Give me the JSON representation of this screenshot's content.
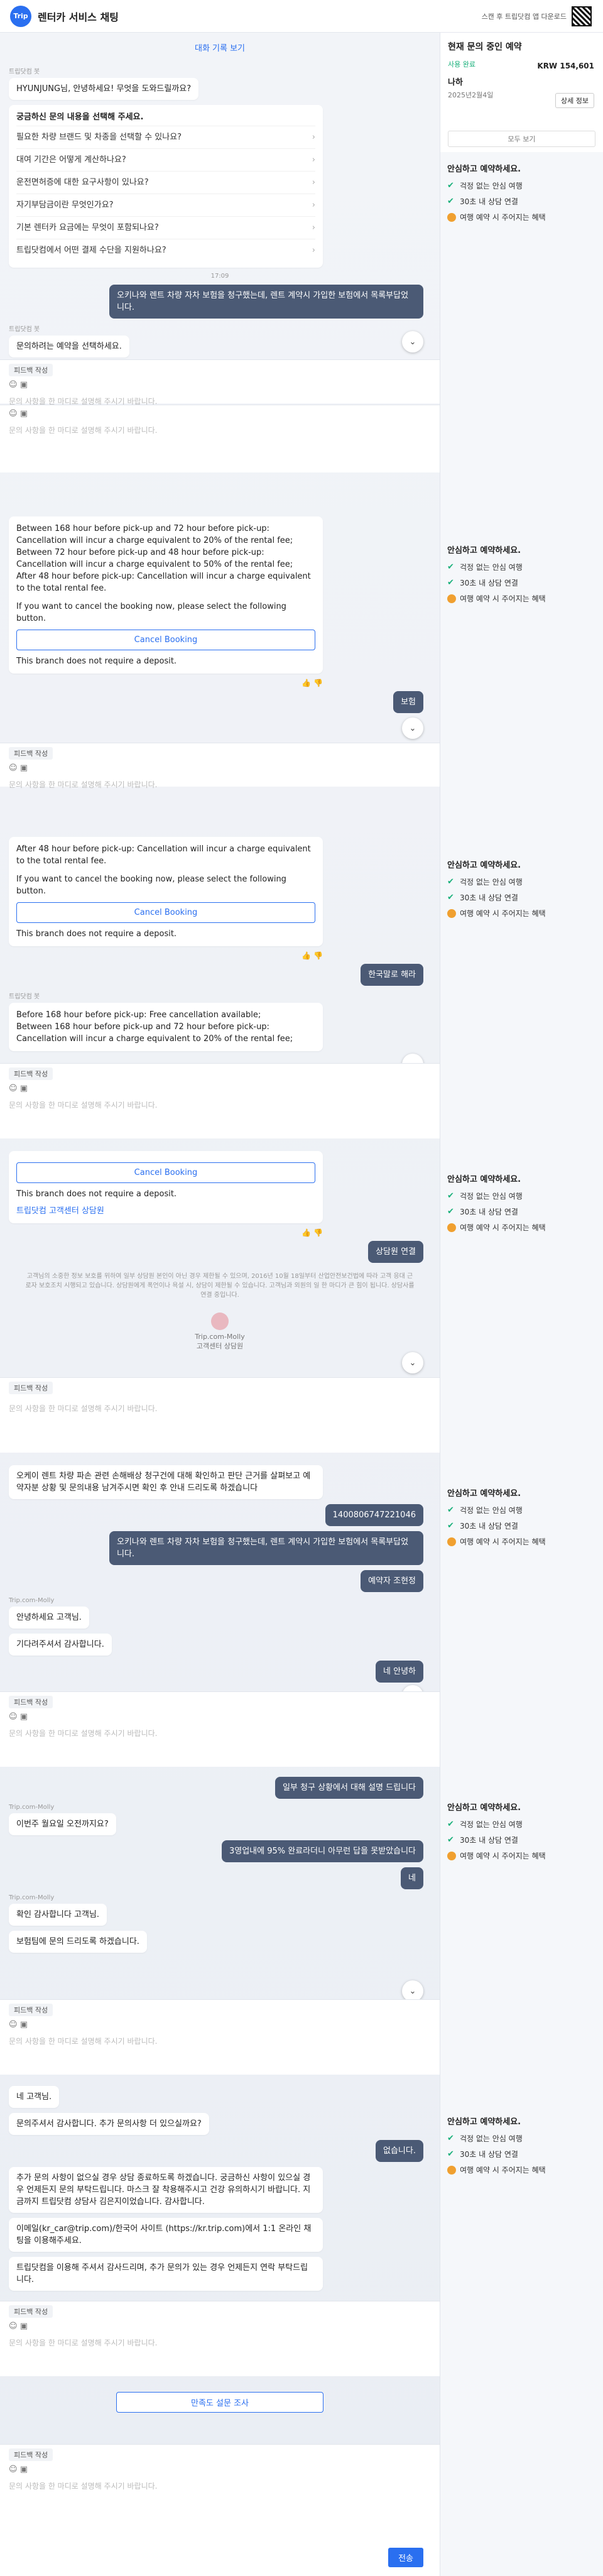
{
  "app": {
    "logo": "Trip",
    "title": "렌터카 서비스 채팅",
    "qr_text": "스캔 후 트립닷컴 앱 다운로드"
  },
  "reservation": {
    "title": "현재 문의 중인 예약",
    "status": "사용 완료",
    "price": "KRW 154,601",
    "name": "나하",
    "date": "2025년2월4일",
    "detail_button": "상세 정보",
    "more_button": "모두 보기"
  },
  "side": {
    "heading": "안심하고 예약하세요.",
    "items": [
      "걱정 없는 안심 여행",
      "30초 내 상담 연결",
      "여행 예약 시 주어지는 혜택"
    ]
  },
  "chat": {
    "history_link": "대화 기록 보기",
    "bot_sender": "트립닷컴 봇",
    "agent_sender": "Trip.com-Molly",
    "greeting": "HYUNJUNG님, 안녕하세요! 무엇을 도와드릴까요?",
    "question_prompt": "궁금하신 문의 내용을 선택해 주세요.",
    "questions": [
      "필요한 차량 브랜드 및 차종을 선택할 수 있나요?",
      "대여 기간은 어떻게 계산하나요?",
      "운전면허증에 대한 요구사항이 있나요?",
      "자기부담금이란 무엇인가요?",
      "기본 렌터카 요금에는 무엇이 포함되나요?",
      "트립닷컴에서 어떤 결제 수단을 지원하나요?"
    ],
    "time": "17:09",
    "user_insurance": "오키나와 렌트 차량 자차 보험을 청구했는데, 렌트 계약시 가입한 보험에서 목록부답었니다.",
    "select_booking": "문의하려는 예약을 선택하세요.",
    "cancel_policy": [
      "Between 168 hour before pick-up and 72 hour before pick-up: Cancellation will incur a charge equivalent to 20% of the rental fee;",
      "Between 72 hour before pick-up and 48 hour before pick-up: Cancellation will incur a charge equivalent to 50% of the rental fee;",
      "After 48 hour before pick-up: Cancellation will incur a charge equivalent to the total rental fee."
    ],
    "cancel_intro": "If you want to cancel the booking now, please select the following button.",
    "cancel_button": "Cancel Booking",
    "deposit_note": "This branch does not require a deposit.",
    "free_cancel": "Before 168 hour before pick-up: Free cancellation available;",
    "user_reply_1": "보험",
    "user_reply_korean": "한국말로 해라",
    "cs_link": "트립닷컴 고객센터 상담원",
    "user_connect": "상담원 연결",
    "disclaimer": "고객님의 소중한 정보 보호를 위하여 일부 상담원 본인이 아닌 경우 제한될 수 있으며, 2016년 10월 18일부터 산업안전보건법에 따라 고객 응대 근로자 보호조치 시행되고 있습니다. 상담원에게 폭언이나 욕설 시, 상담이 제한될 수 있습니다. 고객님과 외원의 일 한 마디가 큰 힘이 됩니다. 상담사를 연결 중입니다.",
    "agent_name": "Trip.com-Molly",
    "agent_role": "고객센터 상담원",
    "agent_check": "오케이 렌트 차량 파손 관련 손해배상 청구건에 대해 확인하고 판단 근거를 살펴보고 예약자분 상황 및 문의내용 남겨주시면 확인 후 안내 드리도록 하겠습니다",
    "booking_no": "1400806747221046",
    "user_insurance_2": "오키나와 렌트 차량 자차 보험을 청구했는데, 렌트 계약시 가입한 보험에서 목록부답었니다.",
    "user_check": "예약자 조현정",
    "agent_hello": "안녕하세요 고객님.",
    "agent_wait": "기다려주셔서 감사합니다.",
    "user_guide": "네 안녕하",
    "user_reply_partial": "일부 청구 상황에서 대해 설명 드립니다",
    "agent_more": "이번주 월요일 오전까지요?",
    "user_long": "3영업내에 95% 완료라더니 아무런 답을 못받았습니다",
    "user_yes": "네",
    "agent_confirm": "확인 감사합니다 고객님.",
    "agent_insurance": "보험팀에 문의 드리도록 하겠습니다.",
    "user_ne": "네 고객님.",
    "agent_more_q": "문의주셔서 감사합니다. 추가 문의사항 더 있으실까요?",
    "user_none": "없습니다.",
    "agent_close": "추가 문의 사항이 없으실 경우 상담 종료하도록 하겠습니다. 궁금하신 사항이 있으실 경우 언제든지 문의 부탁드립니다. 마스크 잘 착용해주시고 건강 유의하시기 바랍니다. 지금까지 트립닷컴 상담사 김은지이었습니다. 감사합니다.",
    "agent_email": "이메일(kr_car@trip.com)/한국어 사이트 (https://kr.trip.com)에서 1:1 온라인 채팅을 이용해주세요.",
    "agent_thanks": "트립닷컴을 이용해 주셔서 감사드리며, 추가 문의가 있는 경우 언제든지 연락 부탁드립니다.",
    "survey_button": "만족도 설문 조사"
  },
  "composer": {
    "tab": "피드백 작성",
    "placeholder": "문의 사항을 한 마디로 설명해 주시기 바랍니다.",
    "send": "전송"
  }
}
